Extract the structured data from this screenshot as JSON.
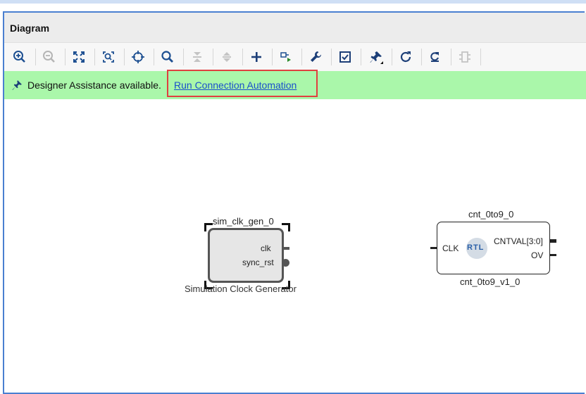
{
  "panel": {
    "title": "Diagram"
  },
  "toolbar": {
    "buttons": [
      {
        "icon": "zoom-in-icon",
        "enabled": true
      },
      {
        "icon": "zoom-out-icon",
        "enabled": false
      },
      {
        "icon": "zoom-fit-icon",
        "enabled": true
      },
      {
        "icon": "zoom-area-icon",
        "enabled": true
      },
      {
        "icon": "auto-fit-selection-icon",
        "enabled": true
      },
      {
        "icon": "search-icon",
        "enabled": true
      },
      {
        "icon": "collapse-all-icon",
        "enabled": false
      },
      {
        "icon": "expand-all-icon",
        "enabled": false
      },
      {
        "icon": "add-ip-icon",
        "enabled": true
      },
      {
        "icon": "make-connection-icon",
        "enabled": true
      },
      {
        "icon": "properties-wrench-icon",
        "enabled": true
      },
      {
        "icon": "validate-design-icon",
        "enabled": true
      },
      {
        "icon": "pin-menu-icon",
        "enabled": true
      },
      {
        "icon": "refresh-icon",
        "enabled": true
      },
      {
        "icon": "regenerate-layout-icon",
        "enabled": true
      },
      {
        "icon": "hierarchy-icon",
        "enabled": false
      }
    ]
  },
  "banner": {
    "message": "Designer Assistance available.",
    "link_label": "Run Connection Automation",
    "background": "#aaf7aa"
  },
  "blocks": {
    "sim_clk": {
      "instance_name": "sim_clk_gen_0",
      "subtitle": "Simulation Clock Generator",
      "ports": [
        "clk",
        "sync_rst"
      ]
    },
    "counter": {
      "instance_name": "cnt_0to9_0",
      "module_name": "cnt_0to9_v1_0",
      "badge": "RTL",
      "input_ports": [
        "CLK"
      ],
      "output_ports": [
        "CNTVAL[3:0]",
        "OV"
      ]
    }
  },
  "colors": {
    "frame_border": "#4a7fd0",
    "highlight": "#e04040",
    "link": "#1a4fcc"
  }
}
